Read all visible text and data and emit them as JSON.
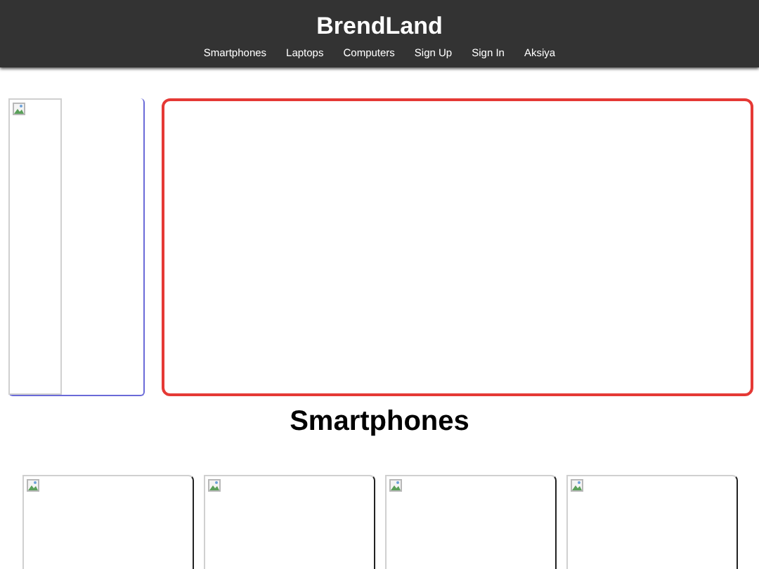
{
  "header": {
    "title": "BrendLand",
    "nav": [
      {
        "label": "Smartphones"
      },
      {
        "label": "Laptops"
      },
      {
        "label": "Computers"
      },
      {
        "label": "Sign Up"
      },
      {
        "label": "Sign In"
      },
      {
        "label": "Aksiya"
      }
    ]
  },
  "banner": {
    "side_image": {
      "kind": "broken_image"
    }
  },
  "section": {
    "title": "Smartphones",
    "products": [
      {
        "kind": "broken_image"
      },
      {
        "kind": "broken_image"
      },
      {
        "kind": "broken_image"
      },
      {
        "kind": "broken_image"
      }
    ]
  }
}
